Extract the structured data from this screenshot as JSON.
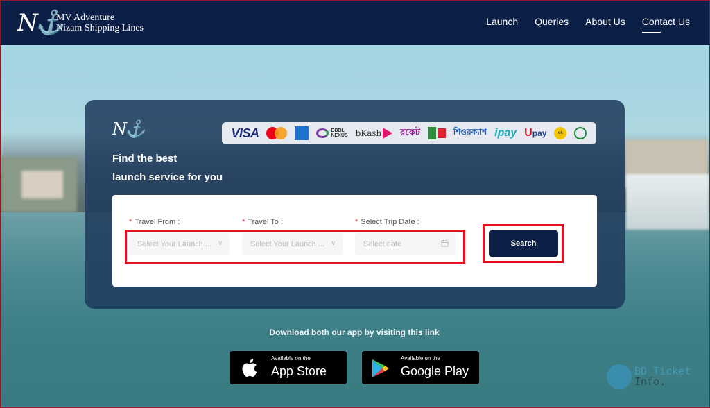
{
  "header": {
    "brand_line1": "MV Adventure",
    "brand_line2": "Nizam Shipping Lines",
    "brand_mark": "N⚓",
    "nav": [
      {
        "label": "Launch",
        "active": false
      },
      {
        "label": "Queries",
        "active": false
      },
      {
        "label": "About Us",
        "active": false
      },
      {
        "label": "Contact Us",
        "active": true
      }
    ]
  },
  "hero": {
    "mark": "N⚓",
    "title_line1": "Find the best",
    "title_line2": "launch service for you",
    "payment_methods": [
      "VISA",
      "Mastercard",
      "American Express",
      "DBBL Nexus",
      "bKash",
      "Rocket",
      "SureCash",
      "ShurjoCash",
      "iPay",
      "Upay",
      "OK Wallet",
      "Islami Bank"
    ],
    "payment_text": {
      "visa": "VISA",
      "dbbl": "DBBL",
      "nexus": "NEXUS",
      "bkash": "bKash",
      "rocket": "রকেট",
      "shurjo": "শিওরক্যাশ",
      "ipay": "ipay",
      "upay_u": "U",
      "upay_pay": "pay",
      "ok": "ok"
    }
  },
  "form": {
    "travel_from": {
      "label": "Travel From :",
      "placeholder": "Select Your Launch ..."
    },
    "travel_to": {
      "label": "Travel To :",
      "placeholder": "Select Your Launch ..."
    },
    "trip_date": {
      "label": "Select Trip Date :",
      "placeholder": "Select date"
    },
    "required_mark": "*",
    "search_label": "Search"
  },
  "download": {
    "text": "Download both our app by visiting this link",
    "app_store": {
      "small": "Available on the",
      "big": "App Store"
    },
    "google_play": {
      "small": "Available on the",
      "big": "Google Play"
    }
  },
  "watermark": {
    "line1": "BD Ticket",
    "line2": "Info."
  },
  "colors": {
    "navy": "#0c1f46",
    "highlight_red": "#e3101f",
    "required_red": "#e0303a"
  }
}
